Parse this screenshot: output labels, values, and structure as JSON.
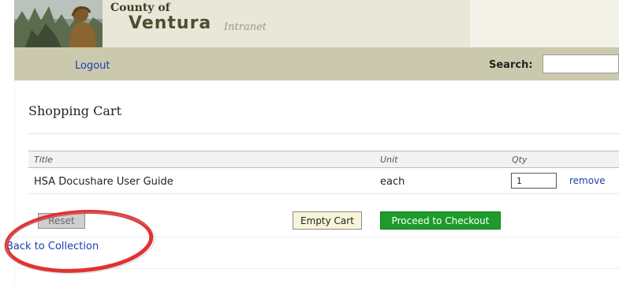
{
  "header": {
    "county_of": "County of",
    "county_name": "Ventura",
    "site_name": "Intranet"
  },
  "nav": {
    "logout_label": "Logout",
    "search_label": "Search:",
    "search_value": ""
  },
  "page_title": "Shopping Cart",
  "cart": {
    "columns": [
      "Title",
      "Unit",
      "Qty"
    ],
    "items": [
      {
        "title": "HSA Docushare User Guide",
        "unit": "each",
        "qty": "1",
        "action": "remove"
      }
    ]
  },
  "buttons": {
    "reset": "Reset",
    "empty_cart": "Empty Cart",
    "checkout": "Proceed to Checkout"
  },
  "back_link": "Back to Collection",
  "colors": {
    "banner": "#e9e7d8",
    "navbar": "#cbc9ad",
    "link": "#1a3fb3",
    "checkout": "#1e9b2a",
    "highlight_circle": "#e02020"
  }
}
